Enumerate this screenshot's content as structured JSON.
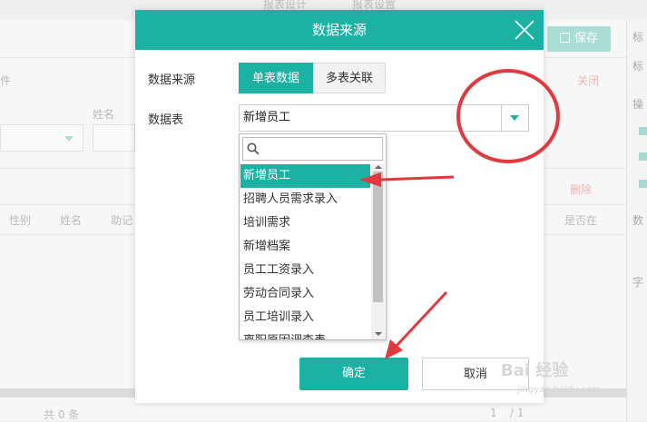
{
  "background": {
    "top_tab_1": "报表设计",
    "top_tab_2": "报表设置",
    "save_label": "保存",
    "side_labels": [
      "标",
      "标",
      "操",
      "数",
      "字"
    ],
    "text_left": "件",
    "field_name_label": "姓名",
    "close_label": "关闭",
    "delete_label": "删除",
    "columns": [
      "性别",
      "姓名",
      "助记"
    ],
    "col_right": "是否在",
    "footer_count": "共 0 条",
    "pager": "1",
    "pager_total": "/ 1"
  },
  "modal": {
    "title": "数据来源",
    "source_label": "数据来源",
    "source_options": [
      "单表数据",
      "多表关联"
    ],
    "selected_source": "单表数据",
    "table_label": "数据表",
    "table_value": "新增员工",
    "search_placeholder": "",
    "items": [
      "新增员工",
      "招聘人员需求录入",
      "培训需求",
      "新增档案",
      "员工工资录入",
      "劳动合同录入",
      "员工培训录入",
      "离职原因调查表"
    ],
    "selected_index": 0,
    "ok_label": "确定",
    "cancel_label": "取消"
  },
  "colors": {
    "accent": "#1bb2a4",
    "annotation": "#e0393e"
  },
  "watermark": {
    "brand": "Bai 经验",
    "url": "jingyan.baidu.com"
  }
}
